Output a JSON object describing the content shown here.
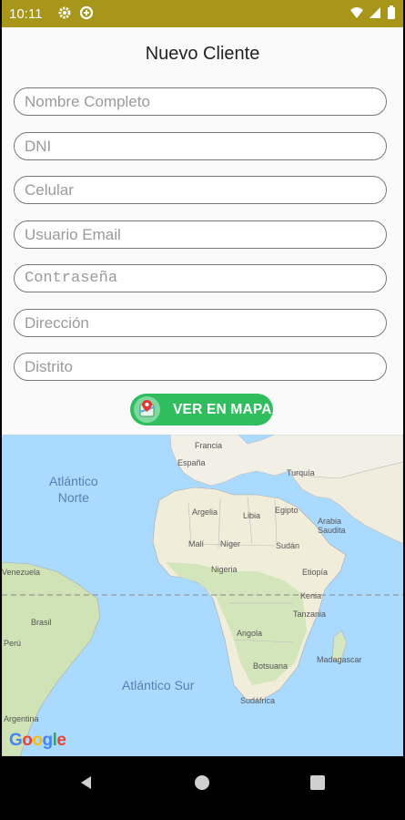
{
  "status_bar": {
    "time": "10:11",
    "color": "#a8961a"
  },
  "header": {
    "title": "Nuevo Cliente"
  },
  "form": {
    "fields": [
      {
        "placeholder": "Nombre Completo"
      },
      {
        "placeholder": "DNI"
      },
      {
        "placeholder": "Celular"
      },
      {
        "placeholder": "Usuario Email"
      },
      {
        "placeholder": "Contraseña"
      },
      {
        "placeholder": "Dirección"
      },
      {
        "placeholder": "Distrito"
      }
    ],
    "map_button": {
      "label": "VER EN MAPA",
      "icon": "map-pin-icon",
      "color": "#2fbd5d"
    }
  },
  "map": {
    "oceans": {
      "north": "Atlántico\nNorte",
      "south": "Atlántico Sur"
    },
    "labels": [
      "Francia",
      "España",
      "Turquía",
      "Egipto",
      "Arabia\nSaudita",
      "Argelia",
      "Libia",
      "Malí",
      "Níger",
      "Sudán",
      "Nigeria",
      "Etiopía",
      "Kenia",
      "Tanzania",
      "Angola",
      "Botsuana",
      "Madagascar",
      "Sudáfrica",
      "Brasil",
      "Perú",
      "Venezuela",
      "Argentina"
    ],
    "logo": "Google"
  },
  "nav_bar": {
    "back": "back-icon",
    "home": "home-icon",
    "recents": "recents-icon"
  }
}
